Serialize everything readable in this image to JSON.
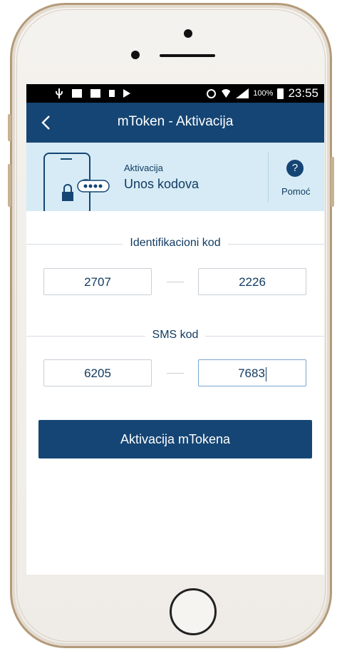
{
  "status_bar": {
    "left_icons": [
      "usb-icon",
      "gallery-icon",
      "youtube-icon",
      "sd-icon",
      "play-store-icon"
    ],
    "right_icons": [
      "alarm-icon",
      "wifi-icon",
      "signal-icon"
    ],
    "battery": "100%",
    "time": "23:55"
  },
  "app_bar": {
    "title": "mToken - Aktivacija",
    "back_icon": "chevron-left-icon"
  },
  "step": {
    "label": "Aktivacija",
    "title": "Unos kodova",
    "help_symbol": "?",
    "help_label": "Pomoć"
  },
  "identification": {
    "label": "Identifikacioni kod",
    "code1": "2707",
    "code2": "2226"
  },
  "sms": {
    "label": "SMS kod",
    "code1": "6205",
    "code2": "7683"
  },
  "action": {
    "label": "Aktivacija mTokena"
  },
  "colors": {
    "primary": "#154574",
    "step_bg": "#d6ebf5",
    "text": "#113b62",
    "border": "#c9cfd6"
  }
}
